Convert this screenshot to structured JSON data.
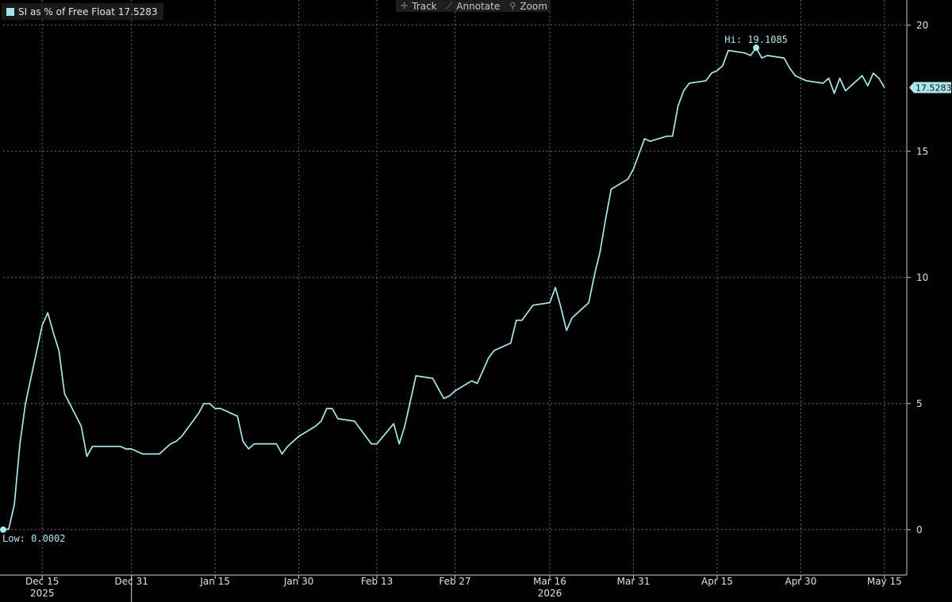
{
  "toolbar": {
    "track": "Track",
    "annotate": "Annotate",
    "zoom": "Zoom"
  },
  "legend": {
    "label": "SI as % of Free Float",
    "value": "17.5283"
  },
  "colors": {
    "line": "#a8e8ee",
    "grid": "#6a6a6a",
    "background": "#000000"
  },
  "chart_data": {
    "type": "line",
    "title": "",
    "series": [
      {
        "name": "SI as % of Free Float",
        "x": [
          "2025-12-08",
          "2025-12-09",
          "2025-12-10",
          "2025-12-11",
          "2025-12-12",
          "2025-12-15",
          "2025-12-16",
          "2025-12-17",
          "2025-12-18",
          "2025-12-19",
          "2025-12-22",
          "2025-12-23",
          "2025-12-24",
          "2025-12-26",
          "2025-12-29",
          "2025-12-30",
          "2025-12-31",
          "2026-01-02",
          "2026-01-05",
          "2026-01-06",
          "2026-01-07",
          "2026-01-08",
          "2026-01-09",
          "2026-01-12",
          "2026-01-13",
          "2026-01-14",
          "2026-01-15",
          "2026-01-16",
          "2026-01-19",
          "2026-01-20",
          "2026-01-21",
          "2026-01-22",
          "2026-01-23",
          "2026-01-26",
          "2026-01-27",
          "2026-01-28",
          "2026-01-29",
          "2026-01-30",
          "2026-02-02",
          "2026-02-03",
          "2026-02-04",
          "2026-02-05",
          "2026-02-06",
          "2026-02-09",
          "2026-02-10",
          "2026-02-11",
          "2026-02-12",
          "2026-02-13",
          "2026-02-16",
          "2026-02-17",
          "2026-02-18",
          "2026-02-19",
          "2026-02-20",
          "2026-02-23",
          "2026-02-24",
          "2026-02-25",
          "2026-02-26",
          "2026-02-27",
          "2026-03-02",
          "2026-03-03",
          "2026-03-04",
          "2026-03-05",
          "2026-03-06",
          "2026-03-09",
          "2026-03-10",
          "2026-03-11",
          "2026-03-12",
          "2026-03-13",
          "2026-03-16",
          "2026-03-17",
          "2026-03-18",
          "2026-03-19",
          "2026-03-20",
          "2026-03-23",
          "2026-03-24",
          "2026-03-25",
          "2026-03-26",
          "2026-03-27",
          "2026-03-30",
          "2026-03-31",
          "2026-04-01",
          "2026-04-02",
          "2026-04-03",
          "2026-04-06",
          "2026-04-07",
          "2026-04-08",
          "2026-04-09",
          "2026-04-10",
          "2026-04-13",
          "2026-04-14",
          "2026-04-15",
          "2026-04-16",
          "2026-04-17",
          "2026-04-20",
          "2026-04-21",
          "2026-04-22",
          "2026-04-23",
          "2026-04-24",
          "2026-04-27",
          "2026-04-28",
          "2026-04-29",
          "2026-04-30",
          "2026-05-01",
          "2026-05-04",
          "2026-05-05",
          "2026-05-06",
          "2026-05-07",
          "2026-05-08",
          "2026-05-11",
          "2026-05-12",
          "2026-05-13",
          "2026-05-14",
          "2026-05-15"
        ],
        "y": [
          0.0002,
          0.02,
          1.0,
          3.4,
          5.0,
          8.1,
          8.6,
          7.8,
          7.1,
          5.4,
          4.1,
          2.9,
          3.3,
          3.3,
          3.3,
          3.2,
          3.2,
          3.0,
          3.0,
          3.2,
          3.4,
          3.5,
          3.7,
          4.6,
          5.0,
          5.0,
          4.8,
          4.8,
          4.5,
          3.5,
          3.2,
          3.4,
          3.4,
          3.4,
          3.0,
          3.3,
          3.5,
          3.7,
          4.1,
          4.3,
          4.8,
          4.8,
          4.4,
          4.3,
          4.0,
          3.7,
          3.4,
          3.4,
          4.2,
          3.4,
          4.1,
          5.1,
          6.1,
          6.0,
          5.6,
          5.2,
          5.3,
          5.5,
          5.9,
          5.8,
          6.3,
          6.8,
          7.1,
          7.4,
          8.3,
          8.3,
          8.6,
          8.9,
          9.0,
          9.6,
          8.8,
          7.9,
          8.4,
          9.0,
          10.1,
          11.0,
          12.3,
          13.5,
          13.9,
          14.3,
          14.9,
          15.5,
          15.4,
          15.6,
          15.6,
          16.8,
          17.4,
          17.7,
          17.8,
          18.1,
          18.2,
          18.4,
          19.0,
          18.9,
          18.8,
          19.1085,
          18.7,
          18.8,
          18.7,
          18.3,
          18.0,
          17.9,
          17.8,
          17.7,
          17.9,
          17.3,
          17.9,
          17.4,
          18.0,
          17.6,
          18.1,
          17.9,
          17.5283
        ]
      }
    ],
    "y_axis": {
      "ticks": [
        0,
        5,
        10,
        15,
        20
      ],
      "range": [
        -1.8,
        21.0
      ],
      "side": "right"
    },
    "x_axis": {
      "range": [
        "2025-12-08",
        "2026-05-19"
      ],
      "ticks": [
        {
          "date": "2025-12-15",
          "label": "Dec 15"
        },
        {
          "date": "2025-12-31",
          "label": "Dec 31"
        },
        {
          "date": "2026-01-15",
          "label": "Jan 15"
        },
        {
          "date": "2026-01-30",
          "label": "Jan 30"
        },
        {
          "date": "2026-02-13",
          "label": "Feb 13"
        },
        {
          "date": "2026-02-27",
          "label": "Feb 27"
        },
        {
          "date": "2026-03-16",
          "label": "Mar 16"
        },
        {
          "date": "2026-03-31",
          "label": "Mar 31"
        },
        {
          "date": "2026-04-15",
          "label": "Apr 15"
        },
        {
          "date": "2026-04-30",
          "label": "Apr 30"
        },
        {
          "date": "2026-05-15",
          "label": "May 15"
        }
      ],
      "years": [
        {
          "date": "2025-12-15",
          "label": "2025"
        },
        {
          "date": "2026-03-16",
          "label": "2026"
        }
      ],
      "year_boundary": "2025-12-31"
    },
    "grid": true,
    "annotations": {
      "high": {
        "label": "Hi: 19.1085",
        "date": "2026-04-22",
        "value": 19.1085
      },
      "low": {
        "label": "Low: 0.0002",
        "date": "2025-12-08",
        "value": 0.0002
      },
      "last": {
        "label": "17.5283",
        "value": 17.5283
      }
    }
  }
}
